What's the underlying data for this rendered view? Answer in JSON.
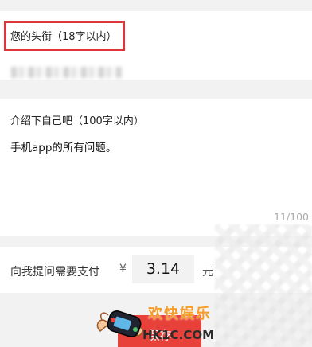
{
  "title_section": {
    "label": "您的头衔（18字以内）"
  },
  "intro_section": {
    "label": "介绍下自己吧（100字以内）",
    "text": "手机app的所有问题。",
    "counter": "11/100"
  },
  "price_section": {
    "label": "向我提问需要支付",
    "currency": "¥",
    "value": "3.14",
    "unit": "元"
  },
  "save_button": {
    "label": "保存"
  },
  "watermark": {
    "title": "欢快娱乐",
    "subtitle": "HK1C.COM",
    "icon": "gamepad-hand-icon"
  },
  "colors": {
    "accent": "#e8413a",
    "highlight_border": "#e0343c",
    "background": "#f2f2f2"
  }
}
